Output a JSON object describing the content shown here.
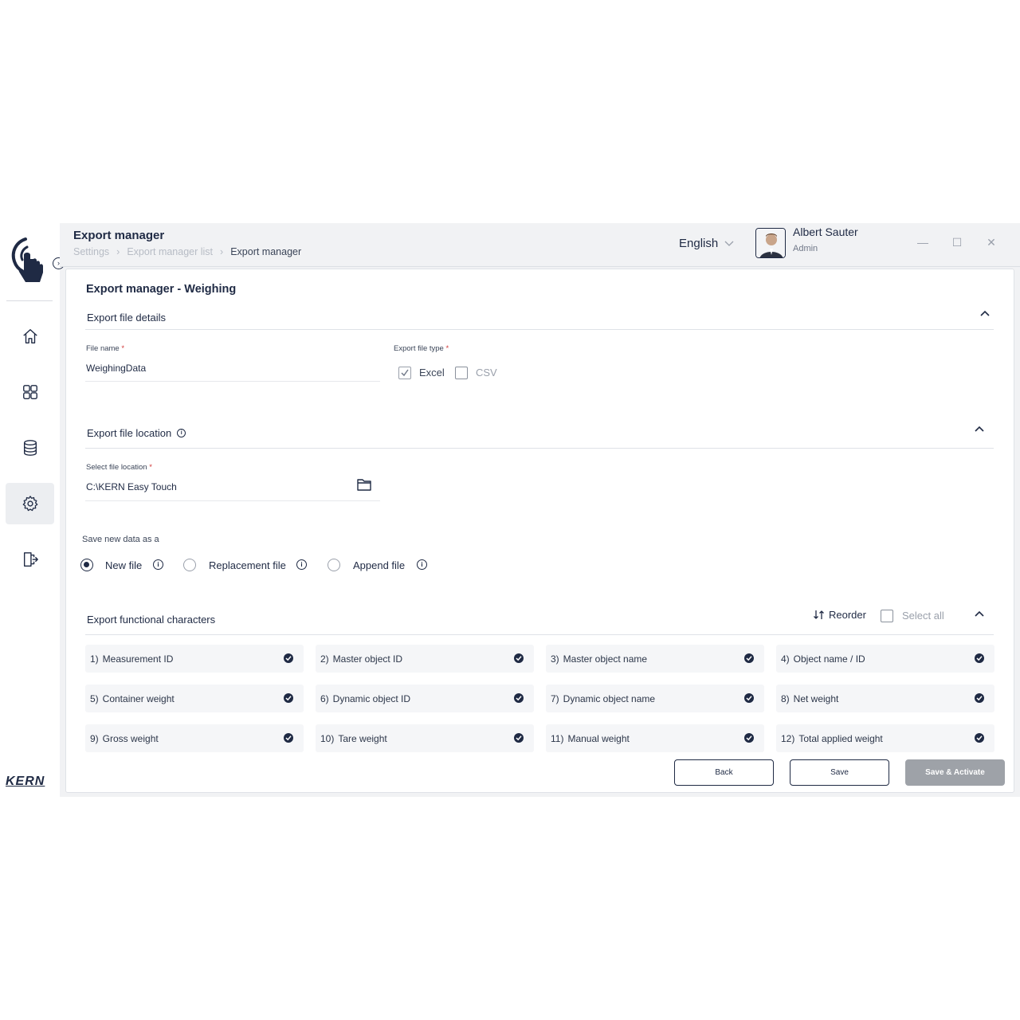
{
  "header": {
    "title": "Export manager",
    "breadcrumb": [
      "Settings",
      "Export manager list",
      "Export manager"
    ],
    "language": "English",
    "user_name": "Albert Sauter",
    "user_role": "Admin"
  },
  "sidebar": {
    "items": [
      "home-icon",
      "apps-grid-icon",
      "database-icon",
      "settings-gear-icon",
      "logout-door-icon"
    ],
    "active_item": "settings-gear-icon",
    "brand": "KERN"
  },
  "card": {
    "title": "Export manager - Weighing",
    "file_details": {
      "section_title": "Export file details",
      "file_name_label": "File name",
      "file_name_value": "WeighingData",
      "file_type_label": "Export file type",
      "excel_label": "Excel",
      "excel_checked": true,
      "csv_label": "CSV",
      "csv_checked": false
    },
    "file_location": {
      "section_title": "Export file location",
      "location_label": "Select file location",
      "location_value": "C:\\KERN Easy Touch"
    },
    "save_as": {
      "label": "Save new data as a",
      "options": [
        "New file",
        "Replacement file",
        "Append file"
      ],
      "selected": "New file"
    },
    "functional_characters": {
      "section_title": "Export functional characters",
      "reorder_label": "Reorder",
      "select_all_label": "Select all",
      "items": [
        {
          "num": "1)",
          "label": "Measurement ID"
        },
        {
          "num": "2)",
          "label": "Master object ID"
        },
        {
          "num": "3)",
          "label": "Master object name"
        },
        {
          "num": "4)",
          "label": "Object name / ID"
        },
        {
          "num": "5)",
          "label": "Container weight"
        },
        {
          "num": "6)",
          "label": "Dynamic object ID"
        },
        {
          "num": "7)",
          "label": "Dynamic object name"
        },
        {
          "num": "8)",
          "label": "Net weight"
        },
        {
          "num": "9)",
          "label": "Gross weight"
        },
        {
          "num": "10)",
          "label": "Tare weight"
        },
        {
          "num": "11)",
          "label": "Manual weight"
        },
        {
          "num": "12)",
          "label": "Total applied weight"
        }
      ]
    },
    "buttons": {
      "back": "Back",
      "save": "Save",
      "save_activate": "Save & Activate"
    }
  },
  "colors": {
    "primary": "#1f2a44",
    "required": "#d13a3a",
    "disabled_button": "#9ea2a8"
  }
}
